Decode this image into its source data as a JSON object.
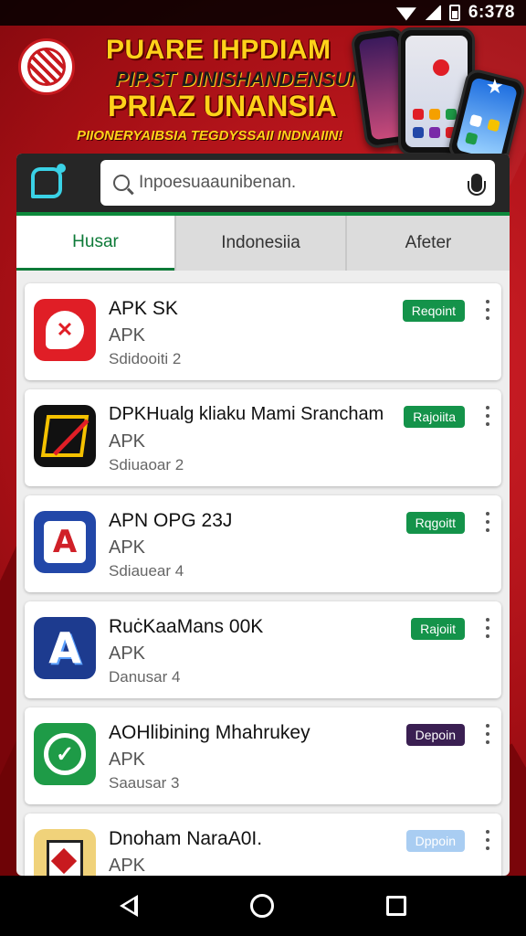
{
  "status_bar": {
    "time": "6:378",
    "icons": [
      "wifi-icon",
      "signal-icon",
      "battery-icon"
    ]
  },
  "banner": {
    "line1": "PUARE IHPDIAM",
    "line2": "PIP.ST DINISHANDENSUN",
    "line3": "PRIAZ UNANSIA",
    "line4": "PIIONERYAIBSIA TEGDYSSAII INDNAIIN!",
    "colors": {
      "title": "#ffd21a",
      "background": "#b8141a"
    }
  },
  "search": {
    "placeholder": "Inpoesuaaunibenan.",
    "logo_icon": "app-logo-icon",
    "mic_icon": "mic-icon",
    "accent": "#0d8a3c"
  },
  "tabs": [
    {
      "label": "Husar",
      "active": true
    },
    {
      "label": "Indonesiia",
      "active": false
    },
    {
      "label": "Afeter",
      "active": false
    }
  ],
  "apps": [
    {
      "name": "APK SK",
      "type": "APK",
      "sub": "Sdidooiti 2",
      "button": "Reqoint",
      "button_color": "#14934a",
      "icon": "red-chat-icon"
    },
    {
      "name": "DPKHualg kliaku Mami Srancham",
      "type": "APK",
      "sub": "Sdiuaoar 2",
      "button": "Rajoiita",
      "button_color": "#14934a",
      "icon": "black-yellow-frame-icon"
    },
    {
      "name": "APN OPG 23J",
      "type": "APK",
      "sub": "Sdiauear 4",
      "button": "Rqgoitt",
      "button_color": "#14934a",
      "icon": "blue-letter-a-icon"
    },
    {
      "name": "RuċKaaMans 00K",
      "type": "APK",
      "sub": "Danusar 4",
      "button": "Rajoiit",
      "button_color": "#14934a",
      "icon": "navy-letter-a-icon"
    },
    {
      "name": "AOHlibining Mhahrukey",
      "type": "APK",
      "sub": "Saausar 3",
      "button": "Depoin",
      "button_color": "#3a1f52",
      "icon": "green-bird-icon"
    },
    {
      "name": "Dnoham NaraA0I.",
      "type": "APK",
      "sub": "",
      "button": "Dppoin",
      "button_color": "#a9cdf2",
      "icon": "yellow-bag-icon"
    }
  ],
  "nav": {
    "back_icon": "back-icon",
    "home_icon": "home-icon",
    "recent_icon": "recent-apps-icon"
  }
}
